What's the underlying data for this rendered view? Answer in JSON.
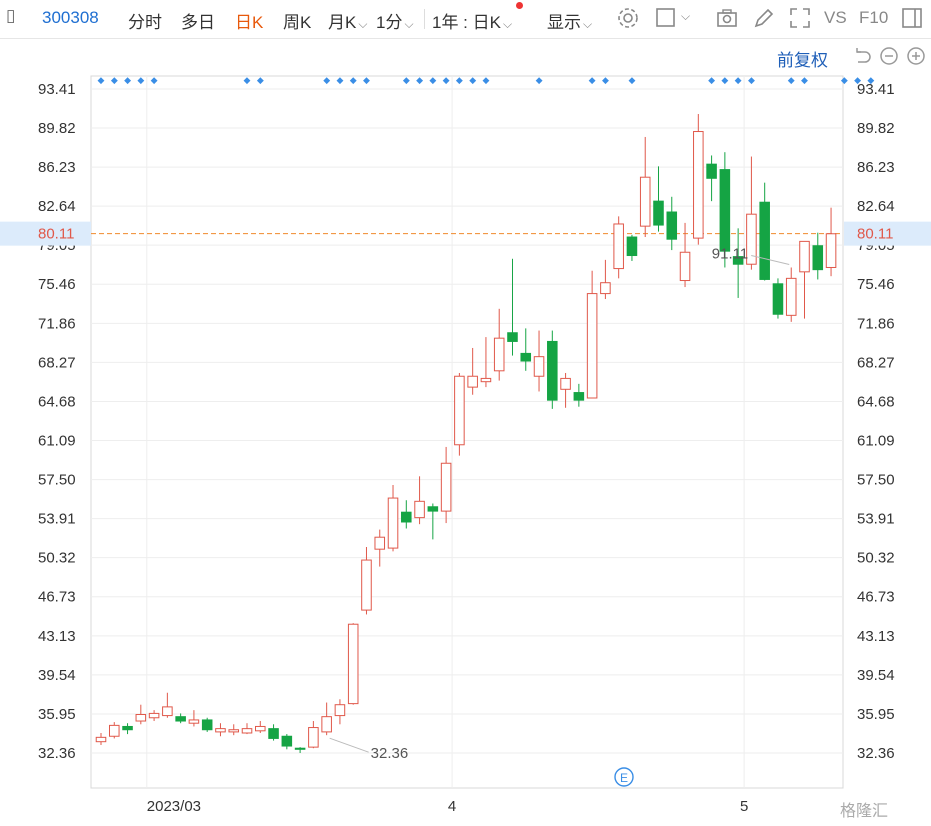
{
  "toolbar": {
    "code": "300308",
    "items": [
      "分时",
      "多日",
      "日K",
      "周K",
      "月K",
      "1分",
      "1年 : 日K",
      "显示"
    ],
    "active": "日K",
    "right": [
      "VS",
      "F10"
    ]
  },
  "adjust_label": "前复权",
  "colors": {
    "up": "#e0584a",
    "down": "#15a444",
    "marker": "#3a8ee6",
    "current": "#f08a2c",
    "axis_hilite": "#dcebfb"
  },
  "watermark": "格隆汇",
  "event_marker": "E",
  "chart_data": {
    "type": "candlestick",
    "y_axis_ticks": [
      93.41,
      89.82,
      86.23,
      82.64,
      79.05,
      75.46,
      71.86,
      68.27,
      64.68,
      61.09,
      57.5,
      53.91,
      50.32,
      46.73,
      43.13,
      39.54,
      35.95,
      32.36
    ],
    "ylim": [
      32.36,
      93.41
    ],
    "x_labels": [
      "2023/03",
      "4",
      "5"
    ],
    "x_label_index": [
      4,
      27,
      49
    ],
    "current_price": 80.11,
    "current_price_label": "80.11",
    "high_annotation": {
      "label": "91.11",
      "index": 52
    },
    "low_annotation": {
      "label": "32.36",
      "index": 17
    },
    "markers_text": "◆",
    "marker_indices": [
      0,
      1,
      2,
      3,
      4,
      11,
      12,
      17,
      18,
      19,
      20,
      23,
      24,
      25,
      26,
      27,
      28,
      29,
      33,
      37,
      38,
      40,
      46,
      47,
      48,
      49,
      52,
      53,
      56,
      57,
      58
    ],
    "candles": [
      {
        "o": 33.4,
        "h": 34.2,
        "l": 33.1,
        "c": 33.8
      },
      {
        "o": 33.9,
        "h": 35.2,
        "l": 33.7,
        "c": 34.9
      },
      {
        "o": 34.8,
        "h": 35.1,
        "l": 34.1,
        "c": 34.5
      },
      {
        "o": 35.3,
        "h": 36.8,
        "l": 35.0,
        "c": 35.9
      },
      {
        "o": 35.6,
        "h": 36.3,
        "l": 35.3,
        "c": 36.0
      },
      {
        "o": 35.8,
        "h": 37.9,
        "l": 35.6,
        "c": 36.6
      },
      {
        "o": 35.7,
        "h": 36.0,
        "l": 35.1,
        "c": 35.3
      },
      {
        "o": 35.1,
        "h": 36.3,
        "l": 34.8,
        "c": 35.4
      },
      {
        "o": 35.4,
        "h": 35.6,
        "l": 34.3,
        "c": 34.5
      },
      {
        "o": 34.3,
        "h": 35.1,
        "l": 33.9,
        "c": 34.6
      },
      {
        "o": 34.3,
        "h": 35.0,
        "l": 34.0,
        "c": 34.5
      },
      {
        "o": 34.2,
        "h": 35.1,
        "l": 34.1,
        "c": 34.6
      },
      {
        "o": 34.4,
        "h": 35.3,
        "l": 34.2,
        "c": 34.8
      },
      {
        "o": 34.6,
        "h": 35.0,
        "l": 33.5,
        "c": 33.7
      },
      {
        "o": 33.9,
        "h": 34.1,
        "l": 32.7,
        "c": 33.0
      },
      {
        "o": 32.8,
        "h": 32.9,
        "l": 32.36,
        "c": 32.7
      },
      {
        "o": 32.9,
        "h": 35.3,
        "l": 32.8,
        "c": 34.7
      },
      {
        "o": 34.3,
        "h": 37.0,
        "l": 34.0,
        "c": 35.7
      },
      {
        "o": 35.8,
        "h": 37.3,
        "l": 35.0,
        "c": 36.8
      },
      {
        "o": 36.9,
        "h": 44.3,
        "l": 36.8,
        "c": 44.2
      },
      {
        "o": 45.5,
        "h": 51.3,
        "l": 45.1,
        "c": 50.1
      },
      {
        "o": 51.1,
        "h": 52.9,
        "l": 49.5,
        "c": 52.2
      },
      {
        "o": 51.2,
        "h": 57.0,
        "l": 50.9,
        "c": 55.8
      },
      {
        "o": 54.5,
        "h": 55.6,
        "l": 53.0,
        "c": 53.6
      },
      {
        "o": 54.0,
        "h": 57.8,
        "l": 53.4,
        "c": 55.5
      },
      {
        "o": 55.0,
        "h": 55.3,
        "l": 52.0,
        "c": 54.6
      },
      {
        "o": 54.6,
        "h": 60.5,
        "l": 53.5,
        "c": 59.0
      },
      {
        "o": 60.7,
        "h": 67.3,
        "l": 59.7,
        "c": 67.0
      },
      {
        "o": 66.0,
        "h": 69.6,
        "l": 65.3,
        "c": 67.0
      },
      {
        "o": 66.5,
        "h": 70.6,
        "l": 66.0,
        "c": 66.8
      },
      {
        "o": 67.5,
        "h": 73.2,
        "l": 66.6,
        "c": 70.5
      },
      {
        "o": 71.0,
        "h": 77.8,
        "l": 68.9,
        "c": 70.2
      },
      {
        "o": 69.1,
        "h": 71.4,
        "l": 67.5,
        "c": 68.4
      },
      {
        "o": 67.0,
        "h": 71.2,
        "l": 65.6,
        "c": 68.8
      },
      {
        "o": 70.2,
        "h": 71.2,
        "l": 64.0,
        "c": 64.8
      },
      {
        "o": 65.8,
        "h": 67.3,
        "l": 64.1,
        "c": 66.8
      },
      {
        "o": 65.5,
        "h": 66.3,
        "l": 64.2,
        "c": 64.8
      },
      {
        "o": 65.0,
        "h": 76.7,
        "l": 65.0,
        "c": 74.6
      },
      {
        "o": 74.6,
        "h": 77.7,
        "l": 74.1,
        "c": 75.6
      },
      {
        "o": 76.9,
        "h": 81.7,
        "l": 76.0,
        "c": 81.0
      },
      {
        "o": 79.8,
        "h": 80.0,
        "l": 77.6,
        "c": 78.1
      },
      {
        "o": 80.8,
        "h": 89.0,
        "l": 79.8,
        "c": 85.3
      },
      {
        "o": 83.1,
        "h": 86.3,
        "l": 80.3,
        "c": 80.9
      },
      {
        "o": 82.1,
        "h": 83.5,
        "l": 78.6,
        "c": 79.6
      },
      {
        "o": 75.8,
        "h": 81.1,
        "l": 75.2,
        "c": 78.4
      },
      {
        "o": 79.7,
        "h": 91.11,
        "l": 79.1,
        "c": 89.5
      },
      {
        "o": 86.5,
        "h": 87.3,
        "l": 83.1,
        "c": 85.2
      },
      {
        "o": 86.0,
        "h": 87.6,
        "l": 77.0,
        "c": 78.5
      },
      {
        "o": 78.0,
        "h": 80.6,
        "l": 74.2,
        "c": 77.3
      },
      {
        "o": 77.3,
        "h": 87.2,
        "l": 76.8,
        "c": 81.9
      },
      {
        "o": 83.0,
        "h": 84.8,
        "l": 75.8,
        "c": 75.9
      },
      {
        "o": 75.5,
        "h": 76.0,
        "l": 72.3,
        "c": 72.7
      },
      {
        "o": 72.6,
        "h": 77.0,
        "l": 72.0,
        "c": 76.0
      },
      {
        "o": 76.6,
        "h": 79.4,
        "l": 72.3,
        "c": 79.4
      },
      {
        "o": 79.0,
        "h": 80.2,
        "l": 75.9,
        "c": 76.8
      },
      {
        "o": 77.0,
        "h": 82.5,
        "l": 76.2,
        "c": 80.1
      }
    ]
  }
}
